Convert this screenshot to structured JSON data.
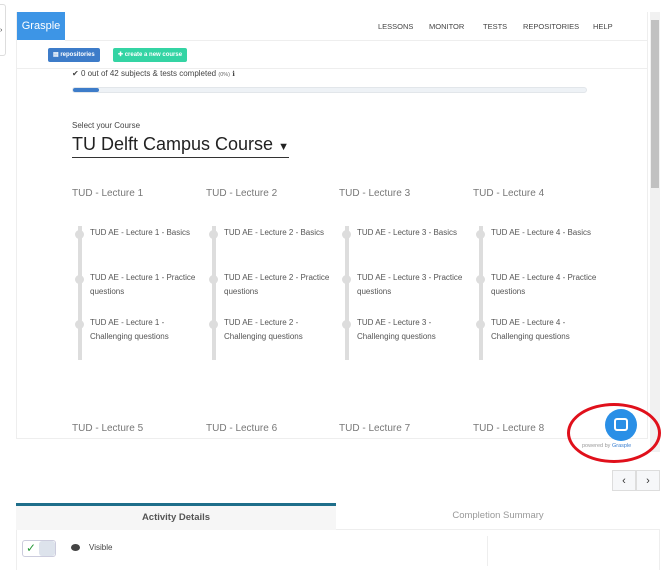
{
  "header": {
    "logo": "Grasple",
    "nav": [
      "LESSONS",
      "MONITOR",
      "TESTS",
      "REPOSITORIES",
      "HELP"
    ],
    "language_flag": "uk-flag-icon"
  },
  "toolbar": {
    "repositories": "repositories",
    "create_course": "create a new course"
  },
  "progress": {
    "text": "0 out of 42 subjects & tests completed",
    "percent_label": "(0%)",
    "percent": 0
  },
  "course": {
    "select_label": "Select your Course",
    "name": "TU Delft Campus Course"
  },
  "lectures": [
    {
      "title": "TUD - Lecture 1",
      "items": [
        "TUD AE - Lecture 1 - Basics",
        "TUD AE - Lecture 1 - Practice questions",
        "TUD AE - Lecture 1 - Challenging questions"
      ]
    },
    {
      "title": "TUD - Lecture 2",
      "items": [
        "TUD AE - Lecture 2 - Basics",
        "TUD AE - Lecture 2 - Practice questions",
        "TUD AE - Lecture 2 - Challenging questions"
      ]
    },
    {
      "title": "TUD - Lecture 3",
      "items": [
        "TUD AE - Lecture 3 - Basics",
        "TUD AE - Lecture 3 - Practice questions",
        "TUD AE - Lecture 3 - Challenging questions"
      ]
    },
    {
      "title": "TUD - Lecture 4",
      "items": [
        "TUD AE - Lecture 4 - Basics",
        "TUD AE - Lecture 4 - Practice questions",
        "TUD AE - Lecture 4 - Challenging questions"
      ]
    }
  ],
  "lectures_row2": [
    "TUD - Lecture 5",
    "TUD - Lecture 6",
    "TUD - Lecture 7",
    "TUD - Lecture 8"
  ],
  "chat": {
    "powered_by": "powered by",
    "brand": "Grasple"
  },
  "pager": {
    "prev": "‹",
    "next": "›"
  },
  "tabs": {
    "activity": "Activity Details",
    "completion": "Completion Summary"
  },
  "panel": {
    "visible": "Visible",
    "check": "✓"
  },
  "colors": {
    "brand": "#3d95e6",
    "accent_green": "#34d4a4",
    "tab_border": "#1e6e8a",
    "highlight": "#e0101b"
  }
}
